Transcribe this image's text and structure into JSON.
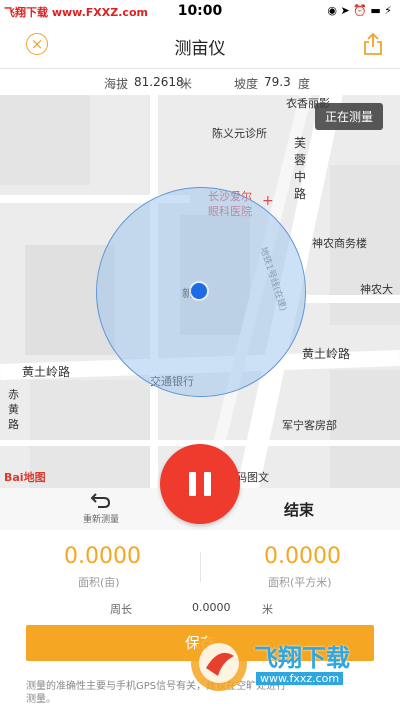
{
  "status": {
    "watermark": "飞翔下载 www.FXXZ.com",
    "time": "10:00",
    "icons": "◉ ➤ ⏰ ▬ ⚡"
  },
  "nav": {
    "title": "测亩仪",
    "close_icon": "close-icon",
    "share_icon": "share-icon"
  },
  "info": {
    "altitude_label": "海拔",
    "altitude_value": "81.2618",
    "altitude_unit": "米",
    "slope_label": "坡度",
    "slope_value": "79.3",
    "slope_unit": "度"
  },
  "map": {
    "measuring_label": "正在测量",
    "labels": {
      "poi1": "衣香丽影",
      "poi2": "陈义元诊所",
      "road1": "芙蓉中路",
      "poi3": "长沙爱尔",
      "poi3b": "眼科医院",
      "poi4": "神农商务楼",
      "poi5": "神农大",
      "metro": "地铁1号线(在建)",
      "poi6": "新空",
      "road2": "黄土岭路",
      "road3": "黄土岭路",
      "poi7": "交通银行",
      "road4": "赤黄路",
      "poi8": "军宁客房部",
      "poi9": "码图文"
    },
    "baidu_logo": "Bai地图",
    "colors": {
      "circle_fill": "#9cc3ee",
      "circle_border": "#5f95d8",
      "location_dot": "#1e6be8"
    }
  },
  "controls": {
    "reset_label": "重新测量",
    "reset_icon": "undo-icon",
    "end_label": "结束",
    "pause_icon": "pause-icon"
  },
  "stats": {
    "area_mu_value": "0.0000",
    "area_mu_label": "面积(亩)",
    "area_m2_value": "0.0000",
    "area_m2_label": "面积(平方米)",
    "perimeter_label": "周长",
    "perimeter_value": "0.0000",
    "perimeter_unit": "米"
  },
  "save_label": "保存",
  "tip": "测量的准确性主要与手机GPS信号有关，建议在空旷处进行测量。",
  "watermark2": {
    "text": "飞翔下载",
    "url": "www.fxxz.com"
  },
  "accent": "#f5a623",
  "pause_color": "#ee3b2e"
}
